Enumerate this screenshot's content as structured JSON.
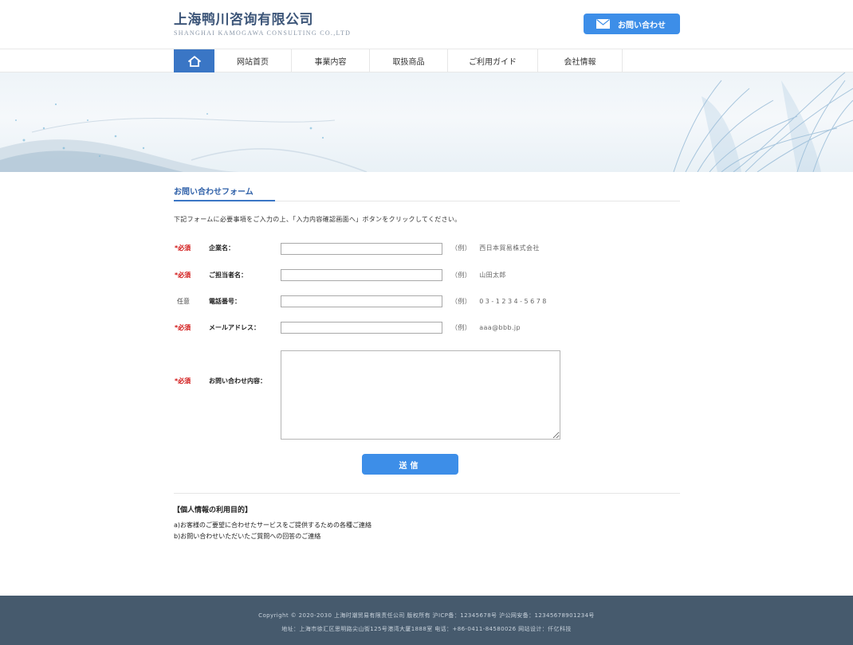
{
  "header": {
    "company_cn": "上海鸭川咨询有限公司",
    "company_en": "SHANGHAI KAMOGAWA CONSULTING CO.,LTD",
    "contact_button": "お問い合わせ"
  },
  "nav": {
    "home_icon": "home-icon",
    "items": [
      {
        "label": "网站首页"
      },
      {
        "label": "事業内容"
      },
      {
        "label": "取扱商品"
      },
      {
        "label": "ご利用ガイド"
      },
      {
        "label": "会社情報"
      }
    ]
  },
  "form": {
    "title": "お問い合わせフォーム",
    "intro": "下記フォームに必要事項をご入力の上、「入力内容確認画面へ」ボタンをクリックしてください。",
    "rows": [
      {
        "required": "*必須",
        "label": "企業名：",
        "value": "",
        "example_prefix": "（例）",
        "example": "西日本貿易株式会社"
      },
      {
        "required": "*必須",
        "label": "ご担当者名：",
        "value": "",
        "example_prefix": "（例）",
        "example": "山田太郎"
      },
      {
        "required": "任意",
        "label": "電話番号：",
        "value": "",
        "example_prefix": "（例）",
        "example": "03-1234-5678"
      },
      {
        "required": "*必須",
        "label": "メールアドレス：",
        "value": "",
        "example_prefix": "（例）",
        "example": "aaa@bbb.jp"
      }
    ],
    "message": {
      "required": "*必須",
      "label": "お問い合わせ内容：",
      "value": ""
    },
    "submit": "送信"
  },
  "privacy": {
    "title": "【個人情報の利用目的】",
    "lines": [
      "a)お客様のご要望に合わせたサービスをご提供するための各種ご連絡",
      "b)お問い合わせいただいたご質問への回答のご連絡"
    ]
  },
  "footer": {
    "line1": "Copyright © 2020-2030 上海时潮贸易有限责任公司 版权所有 沪ICP备：12345678号  沪公网安备：12345678901234号",
    "line2": "地址：上海市徐汇区思明路尖山街125号港湾大厦1888室  电话：+86-0411-84580026  网站设计：仟亿科技"
  },
  "colors": {
    "accent": "#3a76c5",
    "button": "#3d8ee8",
    "required": "#d01010",
    "footer_bg": "#465a6d"
  }
}
